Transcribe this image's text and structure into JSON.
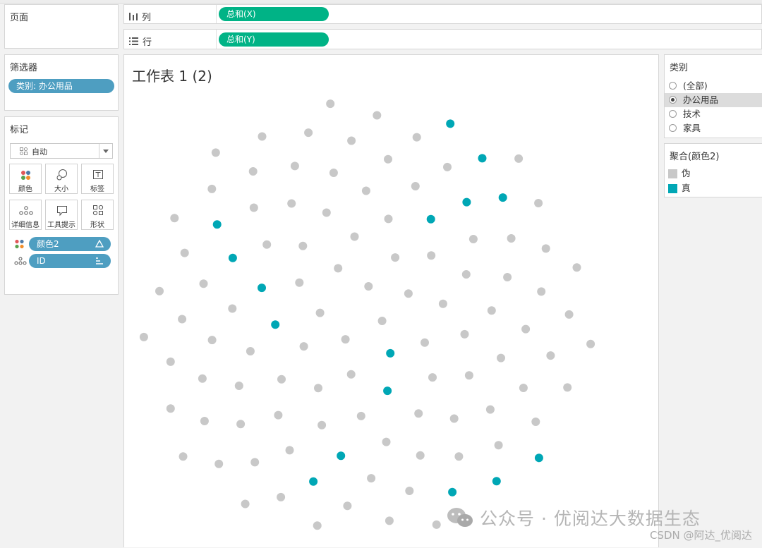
{
  "shelves": {
    "pages_label": "页面",
    "filters_label": "筛选器",
    "marks_label": "标记",
    "columns": {
      "label": "列",
      "pill": "总和(X)"
    },
    "rows": {
      "label": "行",
      "pill": "总和(Y)"
    }
  },
  "filters": {
    "pill": "类别: 办公用品"
  },
  "marks": {
    "type": "自动",
    "buttons": {
      "color": "颜色",
      "size": "大小",
      "label": "标签",
      "detail": "详细信息",
      "tooltip": "工具提示",
      "shape": "形状"
    },
    "fields": [
      {
        "name": "颜色2"
      },
      {
        "name": "ID"
      }
    ]
  },
  "worksheet": {
    "title": "工作表 1 (2)"
  },
  "legend_category": {
    "title": "类别",
    "options": [
      {
        "label": "(全部)",
        "selected": false
      },
      {
        "label": "办公用品",
        "selected": true
      },
      {
        "label": "技术",
        "selected": false
      },
      {
        "label": "家具",
        "selected": false
      }
    ]
  },
  "legend_color": {
    "title": "聚合(颜色2)",
    "items": [
      {
        "label": "伪",
        "color": "#c8c8c8"
      },
      {
        "label": "真",
        "color": "#00a7b5"
      }
    ]
  },
  "colors": {
    "pill_green": "#00b386",
    "pill_blue": "#4e9ec1",
    "dot_false": "#c8c8c8",
    "dot_true": "#00a7b5"
  },
  "watermark": {
    "main": "公众号 · 优阅达大数据生态",
    "credit": "CSDN @阿达_优阅达"
  }
}
